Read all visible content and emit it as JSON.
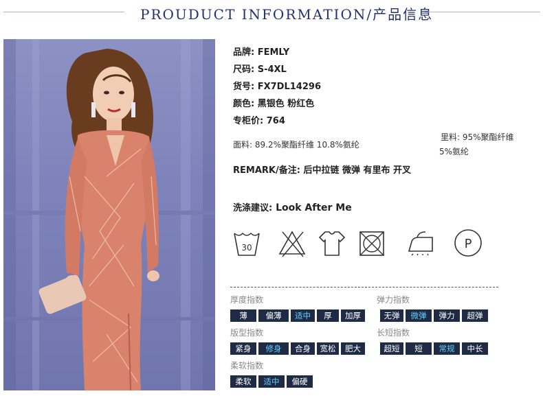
{
  "header": {
    "title": "PROUDUCT INFORMATION/产品信息"
  },
  "product": {
    "brand_label": "品牌:",
    "brand": "FEMLY",
    "size_label": "尺码:",
    "size": "S-4XL",
    "sku_label": "货号:",
    "sku": "FX7DL14296",
    "color_label": "颜色:",
    "color": "黑银色 粉红色",
    "price_label": "专柜价:",
    "price": "764",
    "fabric_label": "面料:",
    "fabric": "89.2%聚酯纤维 10.8%氨纶",
    "lining_label": "里料:",
    "lining_1": "95%聚酯纤维",
    "lining_2": "5%氨纶",
    "remark_label": "REMARK/备注:",
    "remark": "后中拉链 微弹 有里布 开叉",
    "wash_label": "洗涤建议:",
    "wash": "Look After Me"
  },
  "care_icons": [
    "wash-30-icon",
    "no-bleach-icon",
    "no-tumble-dry-icon",
    "no-dry-icon",
    "iron-low-icon",
    "professional-clean-p-icon"
  ],
  "care_text": {
    "wash_temp": "30",
    "pro_clean": "P"
  },
  "indices": {
    "thickness": {
      "title": "厚度指数",
      "options": [
        "薄",
        "偏薄",
        "适中",
        "厚",
        "加厚"
      ],
      "active": 2
    },
    "elasticity": {
      "title": "弹力指数",
      "options": [
        "无弹",
        "微弹",
        "弹力",
        "超弹"
      ],
      "active": 1
    },
    "fit": {
      "title": "版型指数",
      "options": [
        "紧身",
        "修身",
        "合身",
        "宽松",
        "肥大"
      ],
      "active": 1
    },
    "length": {
      "title": "长短指数",
      "options": [
        "超短",
        "短",
        "常规",
        "中长"
      ],
      "active": 2
    },
    "softness": {
      "title": "柔软指数",
      "options": [
        "柔软",
        "适中",
        "偏硬"
      ],
      "active": 1
    }
  },
  "colors": {
    "navy_title": "#23326f",
    "chip_bg": "#1f2a44",
    "chip_active": "#5fd3ff",
    "dress": "#d9826c",
    "backdrop": "#8389bf"
  }
}
